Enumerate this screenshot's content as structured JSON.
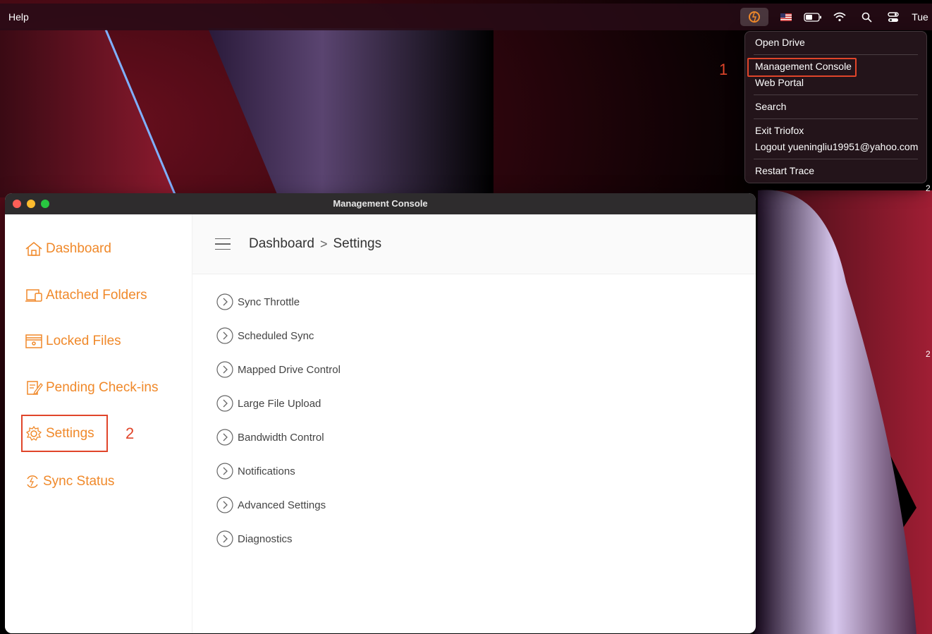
{
  "menubar": {
    "help_label": "Help",
    "status": {
      "clock": "Tue"
    }
  },
  "dropdown": {
    "items": [
      "Open Drive",
      "Management Console",
      "Web Portal",
      "Search",
      "Exit Triofox",
      "Logout yueningliu19951@yahoo.com",
      "Restart Trace"
    ],
    "step_label": "1"
  },
  "edge_numbers": [
    "2",
    "2"
  ],
  "window": {
    "title": "Management Console"
  },
  "sidebar": {
    "items": [
      {
        "label": "Dashboard",
        "icon": "home-icon"
      },
      {
        "label": "Attached Folders",
        "icon": "folders-icon"
      },
      {
        "label": "Locked Files",
        "icon": "locked-files-icon"
      },
      {
        "label": "Pending Check-ins",
        "icon": "pending-checkins-icon"
      },
      {
        "label": "Settings",
        "icon": "gear-icon"
      },
      {
        "label": "Sync Status",
        "icon": "sync-icon"
      }
    ],
    "step_label": "2"
  },
  "breadcrumb": {
    "root": "Dashboard",
    "separator": ">",
    "current": "Settings"
  },
  "settings": [
    "Sync Throttle",
    "Scheduled Sync",
    "Mapped Drive Control",
    "Large File Upload",
    "Bandwidth Control",
    "Notifications",
    "Advanced Settings",
    "Diagnostics"
  ],
  "colors": {
    "accent_orange": "#f0892a",
    "annotation_red": "#e0452a"
  }
}
